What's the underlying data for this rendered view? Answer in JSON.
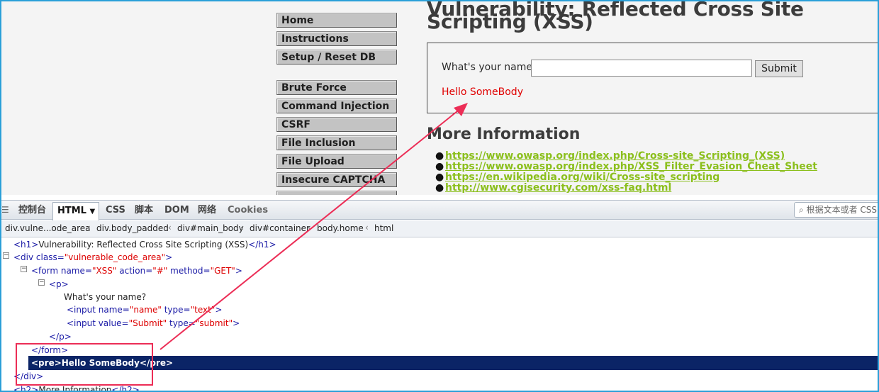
{
  "menu": {
    "items": [
      {
        "label": "Home"
      },
      {
        "label": "Instructions"
      },
      {
        "label": "Setup / Reset DB"
      },
      {
        "label": "Brute Force"
      },
      {
        "label": "Command Injection"
      },
      {
        "label": "CSRF"
      },
      {
        "label": "File Inclusion"
      },
      {
        "label": "File Upload"
      },
      {
        "label": "Insecure CAPTCHA"
      }
    ]
  },
  "main": {
    "title": "Vulnerability: Reflected Cross Site Scripting (XSS)",
    "form": {
      "label": "What's your name?",
      "input_value": "",
      "submit_label": "Submit"
    },
    "output": "Hello SomeBody",
    "more_info_title": "More Information",
    "links": [
      "https://www.owasp.org/index.php/Cross-site_Scripting_(XSS)",
      "https://www.owasp.org/index.php/XSS_Filter_Evasion_Cheat_Sheet",
      "https://en.wikipedia.org/wiki/Cross-site_scripting",
      "http://www.cgisecurity.com/xss-faq.html"
    ]
  },
  "devtools": {
    "tabs": [
      "控制台",
      "HTML",
      "CSS",
      "脚本",
      "DOM",
      "网络",
      "Cookies"
    ],
    "search_placeholder": "根据文本或者 CSS",
    "breadcrumb": [
      "div.vulne...ode_area",
      "div.body_padded",
      "div#main_body",
      "div#container",
      "body.home",
      "html"
    ],
    "html_lines": {
      "h1_open": "<h1>",
      "h1_text": "Vulnerability: Reflected Cross Site Scripting (XSS)",
      "h1_close": "</h1>",
      "div_open_a": "<div class=",
      "div_class": "\"vulnerable_code_area\"",
      "div_open_b": ">",
      "form_a": "<form name=",
      "form_name": "\"XSS\"",
      "form_b": " action=",
      "form_action": "\"#\"",
      "form_c": " method=",
      "form_method": "\"GET\"",
      "form_d": ">",
      "p_open": "<p>",
      "p_text": "What's your name?",
      "input1_a": "<input name=",
      "input1_name": "\"name\"",
      "input1_b": " type=",
      "input1_type": "\"text\"",
      "input1_c": ">",
      "input2_a": "<input value=",
      "input2_value": "\"Submit\"",
      "input2_b": " type=",
      "input2_type": "\"submit\"",
      "input2_c": ">",
      "p_close": "</p>",
      "form_close": "</form>",
      "pre_open": "<pre>",
      "pre_text": "Hello SomeBody",
      "pre_close": "</pre>",
      "div_close": "</div>",
      "h2_open": "<h2>",
      "h2_text": "More Information",
      "h2_close": "</h2>"
    }
  },
  "colors": {
    "annotation": "#ec2d56",
    "link": "#8bbf1c",
    "output": "#e00000",
    "selected_row": "#0b2466"
  }
}
